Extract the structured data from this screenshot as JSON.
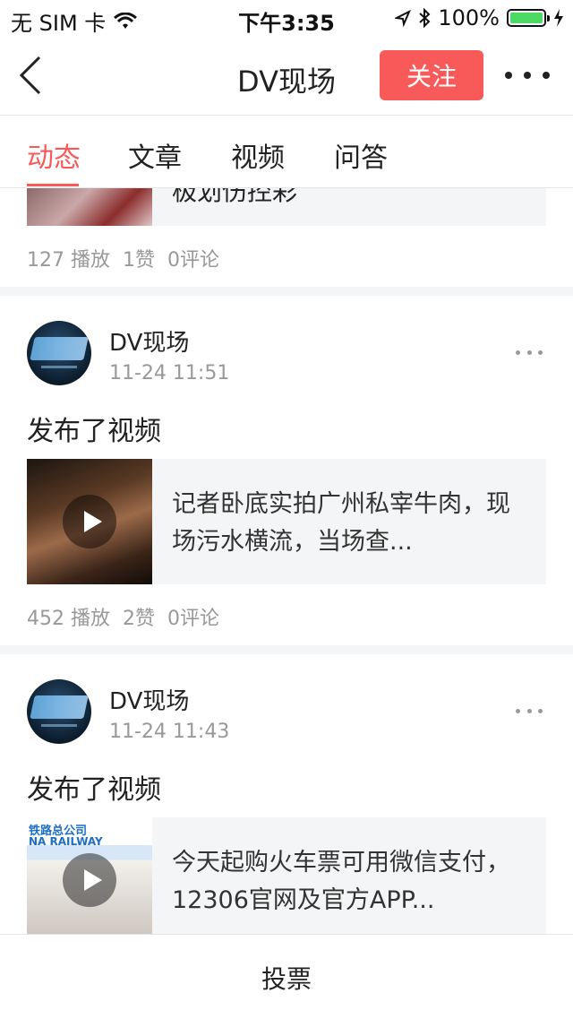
{
  "status_bar": {
    "carrier": "无 SIM 卡",
    "time": "下午3:35",
    "battery": "100%",
    "battery_level": 1.0,
    "icons": [
      "wifi-icon",
      "location-icon",
      "bluetooth-icon",
      "battery-icon",
      "charging-icon"
    ]
  },
  "nav": {
    "title": "DV现场",
    "follow_label": "关注",
    "accent_color": "#f85959"
  },
  "tabs": [
    {
      "label": "动态",
      "active": true
    },
    {
      "label": "文章",
      "active": false
    },
    {
      "label": "视频",
      "active": false
    },
    {
      "label": "问答",
      "active": false
    }
  ],
  "feed": {
    "partial_item": {
      "text_fragment": "极划伤控彩",
      "stats": {
        "plays": "127 播放",
        "likes": "1赞",
        "comments": "0评论"
      }
    },
    "posts": [
      {
        "author": "DV现场",
        "time": "11-24 11:51",
        "text": "发布了视频",
        "media_title": "记者卧底实拍广州私宰牛肉，现场污水横流，当场查...",
        "stats": {
          "plays": "452 播放",
          "likes": "2赞",
          "comments": "0评论"
        }
      },
      {
        "author": "DV现场",
        "time": "11-24 11:43",
        "text": "发布了视频",
        "media_title": "今天起购火车票可用微信支付，12306官网及官方APP...",
        "thumb_text": "铁路总公司",
        "thumb_text2": "NA RAILWAY"
      }
    ]
  },
  "bottom_bar": {
    "vote_label": "投票"
  }
}
